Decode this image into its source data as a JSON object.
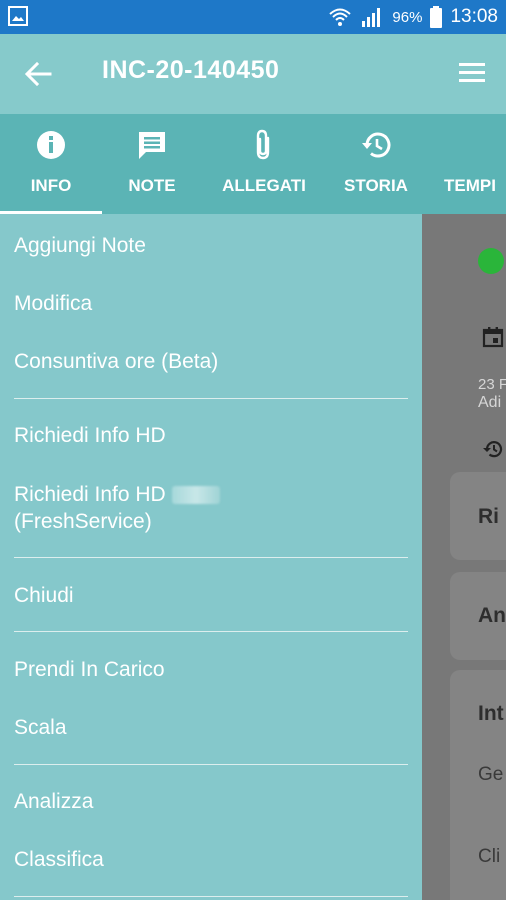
{
  "status_bar": {
    "battery_percent": "96%",
    "time": "13:08"
  },
  "app_bar": {
    "title": "INC-20-140450"
  },
  "tabs": [
    {
      "label": "INFO",
      "icon": "info-icon",
      "selected": true
    },
    {
      "label": "NOTE",
      "icon": "comment-icon",
      "selected": false
    },
    {
      "label": "ALLEGATI",
      "icon": "paperclip-icon",
      "selected": false
    },
    {
      "label": "STORIA",
      "icon": "history-icon",
      "selected": false
    },
    {
      "label": "TEMPI",
      "icon": "clock-icon",
      "selected": false
    }
  ],
  "drawer": {
    "items": [
      "Aggiungi Note",
      "Modifica",
      "Consuntiva ore (Beta)",
      "Richiedi Info HD",
      "Richiedi Info HD",
      "(FreshService)",
      "Chiudi",
      "Prendi In Carico",
      "Scala",
      "Analizza",
      "Classifica"
    ]
  },
  "content_peek": {
    "date_fragment": "23 F",
    "line2": "Adi",
    "card1": "Ri",
    "card2": "An",
    "section": "Int",
    "field1": "Ge",
    "field2": "Cli"
  }
}
